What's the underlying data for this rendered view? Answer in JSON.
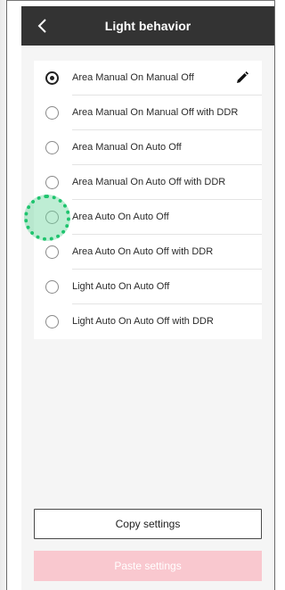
{
  "header": {
    "title": "Light behavior",
    "back_icon": "chevron-left-icon"
  },
  "options": [
    {
      "label": "Area Manual On Manual Off",
      "selected": true,
      "editable": true
    },
    {
      "label": "Area Manual On Manual Off with DDR",
      "selected": false
    },
    {
      "label": "Area Manual On Auto Off",
      "selected": false
    },
    {
      "label": "Area Manual On Auto Off with DDR",
      "selected": false
    },
    {
      "label": "Area Auto On Auto Off",
      "selected": false
    },
    {
      "label": "Area Auto On Auto Off with DDR",
      "selected": false
    },
    {
      "label": "Light Auto On Auto Off",
      "selected": false
    },
    {
      "label": "Light Auto On Auto Off with DDR",
      "selected": false
    }
  ],
  "edit_icon": "pencil-icon",
  "actions": {
    "copy_label": "Copy settings",
    "paste_label": "Paste settings",
    "paste_enabled": false
  },
  "colors": {
    "app_bar": "#333333",
    "screen_background": "#f5f5f5",
    "paste_disabled": "#f9c8cf",
    "touch_indicator": "#1ec46e"
  }
}
